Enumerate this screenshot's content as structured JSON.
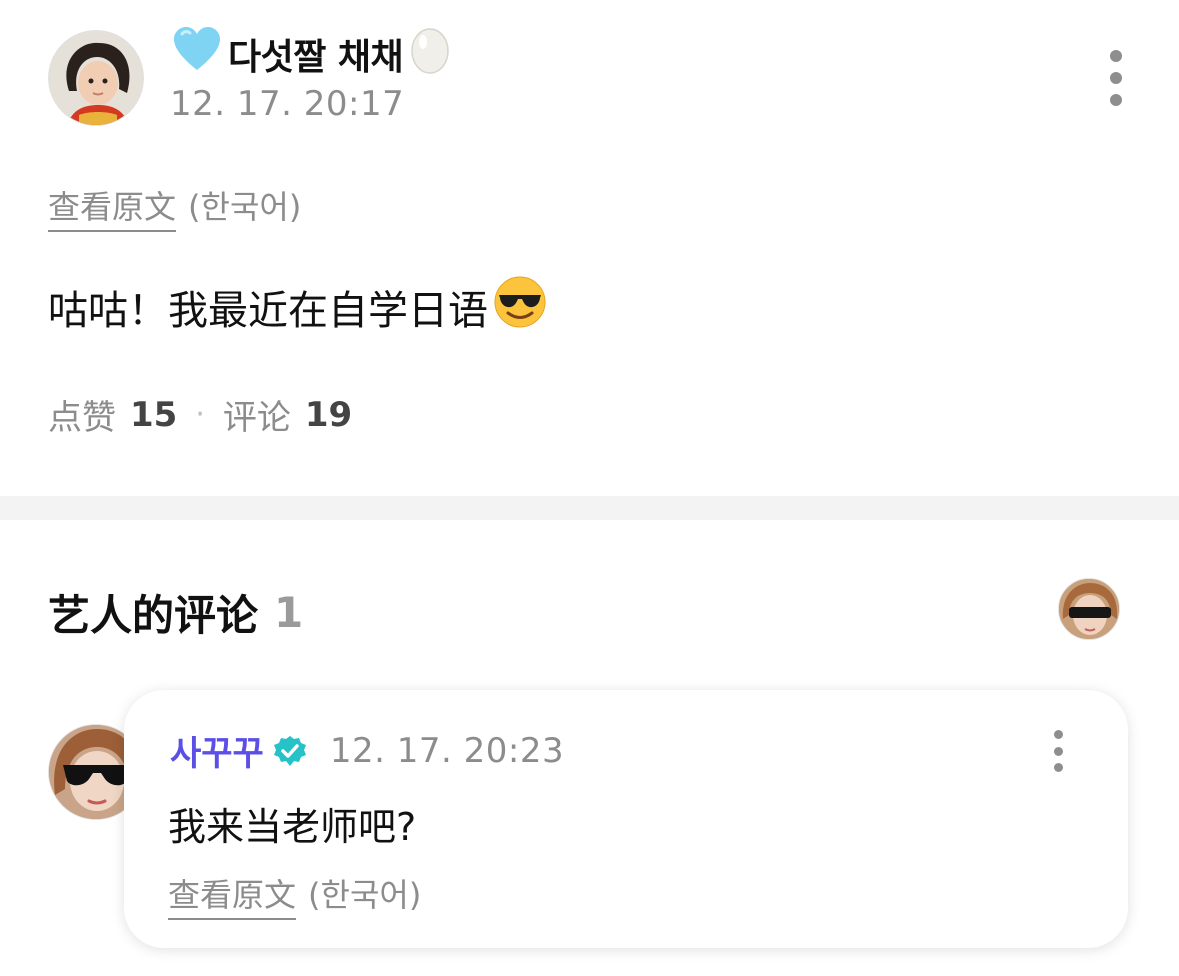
{
  "post": {
    "author_name": "다섯짤 채채",
    "author_prefix_icon": "light-blue-heart-icon",
    "author_suffix_icon": "egg-icon",
    "timestamp": "12. 17. 20:17",
    "translate_link": "查看原文",
    "translate_lang": "(한국어)",
    "body_text": "咕咕！我最近在自学日语",
    "body_emoji": "smiling-face-with-sunglasses-icon",
    "likes_label": "点赞",
    "likes_count": "15",
    "stats_separator": "·",
    "comments_label": "评论",
    "comments_count": "19"
  },
  "artist_comments": {
    "title": "艺人的评论",
    "count": "1",
    "comment": {
      "author_name": "사꾸꾸",
      "badge": "verified-badge-icon",
      "timestamp": "12. 17. 20:23",
      "text": "我来当老师吧?",
      "translate_link": "查看原文",
      "translate_lang": "(한국어)"
    }
  },
  "colors": {
    "artist_name": "#5b4fe6",
    "verified_badge": "#25c2c8",
    "muted_text": "#8c8c8c",
    "divider": "#f3f3f3"
  }
}
